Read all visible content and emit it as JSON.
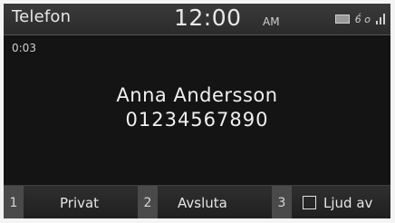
{
  "header": {
    "title": "Telefon",
    "time": "12:00",
    "ampm": "AM",
    "status_text": "6́ o"
  },
  "call": {
    "duration": "0:03",
    "caller_name": "Anna Andersson",
    "caller_number": "01234567890"
  },
  "softkeys": [
    {
      "number": "1",
      "label": "Privat"
    },
    {
      "number": "2",
      "label": "Avsluta"
    },
    {
      "number": "3",
      "label": "Ljud av",
      "checked": false
    }
  ]
}
